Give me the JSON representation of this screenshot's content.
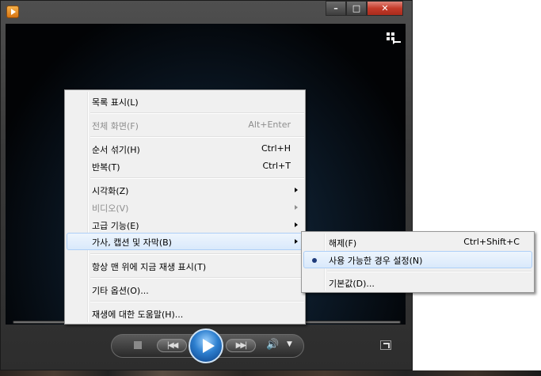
{
  "window": {
    "caption_min": "–",
    "caption_max": "□",
    "caption_close": "✕"
  },
  "controls": {
    "prev_glyph": "|◀◀",
    "next_glyph": "▶▶|",
    "volume_glyph": "🔊",
    "volume_arrow_glyph": "▼"
  },
  "menu": {
    "items": [
      {
        "label": "목록 표시(L)",
        "shortcut": ""
      },
      {
        "label": "전체 화면(F)",
        "shortcut": "Alt+Enter"
      },
      {
        "label": "순서 섞기(H)",
        "shortcut": "Ctrl+H"
      },
      {
        "label": "반복(T)",
        "shortcut": "Ctrl+T"
      },
      {
        "label": "시각화(Z)",
        "shortcut": ""
      },
      {
        "label": "비디오(V)",
        "shortcut": ""
      },
      {
        "label": "고급 기능(E)",
        "shortcut": ""
      },
      {
        "label": "가사, 캡션 및 자막(B)",
        "shortcut": ""
      },
      {
        "label": "항상 맨 위에 지금 재생 표시(T)",
        "shortcut": ""
      },
      {
        "label": "기타 옵션(O)...",
        "shortcut": ""
      },
      {
        "label": "재생에 대한 도움말(H)...",
        "shortcut": ""
      }
    ]
  },
  "submenu": {
    "items": [
      {
        "label": "해제(F)",
        "shortcut": "Ctrl+Shift+C"
      },
      {
        "label": "사용 가능한 경우 설정(N)",
        "shortcut": ""
      },
      {
        "label": "기본값(D)...",
        "shortcut": ""
      }
    ]
  },
  "colors": {
    "highlight_border": "#aecff7",
    "highlight_fill": "#d9e9fb",
    "play_button": "#2d7fcf",
    "close_button": "#c43b2a"
  }
}
